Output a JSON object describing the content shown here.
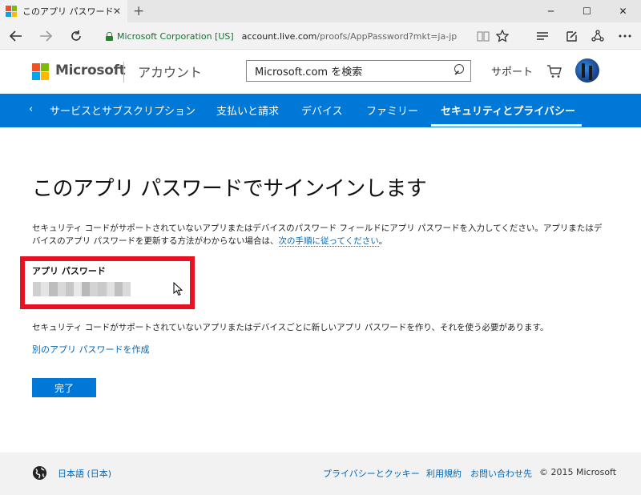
{
  "browser": {
    "tab_title": "このアプリ パスワードでサイン",
    "tab_close": "✕",
    "new_tab": "+",
    "url_org": "Microsoft Corporation [US]",
    "url_domain": "account.live.com",
    "url_path": "/proofs/AppPassword?mkt=ja-jp"
  },
  "header": {
    "brand": "Microsoft",
    "section": "アカウント",
    "search_text": "Microsoft.com を検索",
    "support": "サポート"
  },
  "nav": {
    "back": "‹",
    "items": [
      "サービスとサブスクリプション",
      "支払いと請求",
      "デバイス",
      "ファミリー",
      "セキュリティとプライバシー"
    ],
    "active_index": 4
  },
  "content": {
    "title": "このアプリ パスワードでサインインします",
    "desc_text": "セキュリティ コードがサポートされていないアプリまたはデバイスのパスワード フィールドにアプリ パスワードを入力してください。アプリまたはデバイスのアプリ パスワードを更新する方法がわからない場合は、",
    "desc_link": "次の手順に従ってください",
    "desc_end": "。",
    "pw_label": "アプリ パスワード",
    "info": "セキュリティ コードがサポートされていないアプリまたはデバイスごとに新しいアプリ パスワードを作り、それを使う必要があります。",
    "create_link": "別のアプリ パスワードを作成",
    "done_button": "完了"
  },
  "footer": {
    "language": "日本語 (日本)",
    "links": [
      "プライバシーとクッキー",
      "利用規約",
      "お問い合わせ先"
    ],
    "copyright": "© 2015 Microsoft"
  },
  "colors": {
    "accent": "#0078d7",
    "link": "#0067b8",
    "highlight_box": "#e81123",
    "logo": [
      "#f25022",
      "#7fba00",
      "#00a4ef",
      "#ffb900"
    ]
  }
}
